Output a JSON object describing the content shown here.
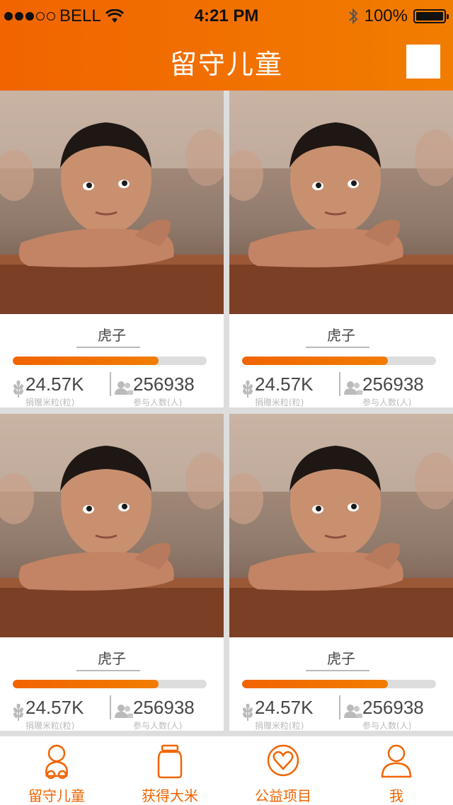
{
  "status_bar": {
    "carrier": "BELL",
    "time": "4:21 PM",
    "battery": "100%"
  },
  "header": {
    "title": "留守儿童"
  },
  "cards": [
    {
      "name": "虎子",
      "progress": 0.75,
      "rice": "24.57K",
      "rice_label": "捐赠米粒(粒)",
      "people": "256938",
      "people_label": "参与人数(人)"
    },
    {
      "name": "虎子",
      "progress": 0.75,
      "rice": "24.57K",
      "rice_label": "捐赠米粒(粒)",
      "people": "256938",
      "people_label": "参与人数(人)"
    },
    {
      "name": "虎子",
      "progress": 0.75,
      "rice": "24.57K",
      "rice_label": "捐赠米粒(粒)",
      "people": "256938",
      "people_label": "参与人数(人)"
    },
    {
      "name": "虎子",
      "progress": 0.75,
      "rice": "24.57K",
      "rice_label": "捐赠米粒(粒)",
      "people": "256938",
      "people_label": "参与人数(人)"
    }
  ],
  "tabs": [
    {
      "label": "留守儿童",
      "icon": "child-icon"
    },
    {
      "label": "获得大米",
      "icon": "rice-jar-icon"
    },
    {
      "label": "公益项目",
      "icon": "heart-ribbon-icon"
    },
    {
      "label": "我",
      "icon": "user-icon"
    }
  ],
  "colors": {
    "gradient_start": "#f16400",
    "gradient_end": "#f17d00",
    "text": "#464646",
    "muted": "#bababa",
    "track": "#dddddd"
  }
}
